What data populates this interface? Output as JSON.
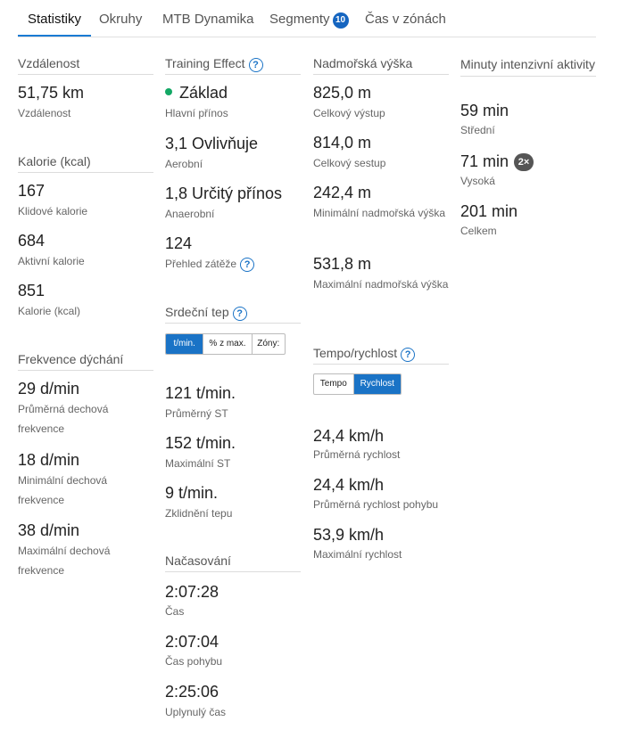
{
  "tabs": [
    {
      "label": "Statistiky"
    },
    {
      "label": "Okruhy"
    },
    {
      "label": "MTB Dynamika"
    },
    {
      "label": "Segmenty",
      "badge": "10"
    },
    {
      "label": "Čas v zónách"
    }
  ],
  "distance": {
    "title": "Vzdálenost",
    "value": "51,75 km",
    "label": "Vzdálenost"
  },
  "calories": {
    "title": "Kalorie (kcal)",
    "items": [
      {
        "value": "167",
        "label": "Klidové kalorie"
      },
      {
        "value": "684",
        "label": "Aktivní kalorie"
      },
      {
        "value": "851",
        "label": "Kalorie (kcal)"
      }
    ]
  },
  "breathing": {
    "title": "Frekvence dýchání",
    "items": [
      {
        "value": "29 d/min",
        "label": "Průměrná dechová frekvence"
      },
      {
        "value": "18 d/min",
        "label": "Minimální dechová frekvence"
      },
      {
        "value": "38 d/min",
        "label": "Maximální dechová frekvence"
      }
    ]
  },
  "training_effect": {
    "title": "Training Effect",
    "help_icon": "?",
    "dot_color": "#13a865",
    "items": [
      {
        "value": "Základ",
        "label": "Hlavní přínos"
      },
      {
        "value": "3,1 Ovlivňuje",
        "label": "Aerobní"
      },
      {
        "value": "1,8 Určitý přínos",
        "label": "Anaerobní"
      },
      {
        "value": "124",
        "label": "Přehled zátěže"
      }
    ]
  },
  "heart_rate": {
    "title": "Srdeční tep",
    "help_icon": "?",
    "toggle": [
      "t/min.",
      "% z max.",
      "Zóny:"
    ],
    "items": [
      {
        "value": "121 t/min.",
        "label": "Průměrný ST"
      },
      {
        "value": "152 t/min.",
        "label": "Maximální ST"
      },
      {
        "value": "9 t/min.",
        "label": "Zklidnění tepu"
      }
    ]
  },
  "timing": {
    "title": "Načasování",
    "items": [
      {
        "value": "2:07:28",
        "label": "Čas"
      },
      {
        "value": "2:07:04",
        "label": "Čas pohybu"
      },
      {
        "value": "2:25:06",
        "label": "Uplynulý čas"
      }
    ]
  },
  "elevation": {
    "title": "Nadmořská výška",
    "items": [
      {
        "value": "825,0 m",
        "label": "Celkový výstup"
      },
      {
        "value": "814,0 m",
        "label": "Celkový sestup"
      },
      {
        "value": "242,4 m",
        "label": "Minimální nadmořská výška"
      },
      {
        "value": "531,8 m",
        "label": "Maximální nadmořská výška"
      }
    ]
  },
  "speed": {
    "title": "Tempo/rychlost",
    "help_icon": "?",
    "toggle": [
      "Tempo",
      "Rychlost"
    ],
    "items": [
      {
        "value": "24,4 km/h",
        "label": "Průměrná rychlost"
      },
      {
        "value": "24,4 km/h",
        "label": "Průměrná rychlost pohybu"
      },
      {
        "value": "53,9 km/h",
        "label": "Maximální rychlost"
      }
    ]
  },
  "intensity": {
    "title": "Minuty intenzivní aktivity",
    "badge": "2×",
    "items": [
      {
        "value": "59 min",
        "label": "Střední"
      },
      {
        "value": "71 min",
        "label": "Vysoká"
      },
      {
        "value": "201 min",
        "label": "Celkem"
      }
    ]
  }
}
